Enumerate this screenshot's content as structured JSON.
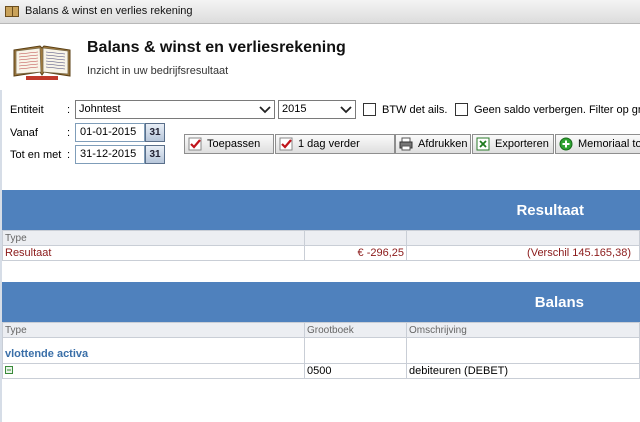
{
  "window": {
    "title": "Balans & winst en verlies rekening"
  },
  "header": {
    "title": "Balans & winst en verliesrekening",
    "subtitle": "Inzicht in uw bedrijfsresultaat"
  },
  "filters": {
    "entiteit_label": "Entiteit",
    "entiteit_value": "Johntest",
    "year_value": "2015",
    "btw_label": "BTW det ails.",
    "saldo_label": "Geen saldo verbergen. Filter op gr",
    "vanaf_label": "Vanaf",
    "vanaf_value": "01-01-2015",
    "tot_label": "Tot en met",
    "tot_value": "31-12-2015",
    "calendar_text": "31",
    "colon": ":"
  },
  "toolbar": {
    "toepassen": "Toepassen",
    "dag_verder": "1 dag verder",
    "afdrukken": "Afdrukken",
    "exporteren": "Exporteren",
    "memoriaal": "Memoriaal toe"
  },
  "resultaat": {
    "heading": "Resultaat",
    "header_type": "Type",
    "row": {
      "type": "Resultaat",
      "amount": "€ -296,25",
      "verschil": "(Verschil 145.165,38)"
    }
  },
  "balans": {
    "heading": "Balans",
    "columns": [
      "Type",
      "Grootboek",
      "Omschrijving"
    ],
    "group_label": "vlottende activa",
    "row": {
      "grootboek": "0500",
      "omschrijving": "debiteuren (DEBET)"
    }
  },
  "colors": {
    "section_blue": "#4f81bd",
    "result_red": "#8b1a1a",
    "group_blue": "#3a6fa8"
  }
}
